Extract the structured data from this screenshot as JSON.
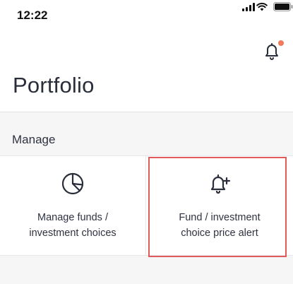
{
  "status_bar": {
    "time": "12:22",
    "icons": [
      "signal-icon",
      "wifi-icon",
      "battery-icon"
    ]
  },
  "header": {
    "notification_icon": "bell-icon",
    "notification_dot_color": "#f07a5a",
    "title": "Portfolio"
  },
  "manage": {
    "section_title": "Manage",
    "tiles": [
      {
        "icon": "pie-chart-icon",
        "label_line1": "Manage funds /",
        "label_line2": "investment choices"
      },
      {
        "icon": "bell-plus-icon",
        "label_line1": "Fund / investment",
        "label_line2": "choice price alert",
        "highlight_color": "#e05a5a"
      }
    ]
  }
}
